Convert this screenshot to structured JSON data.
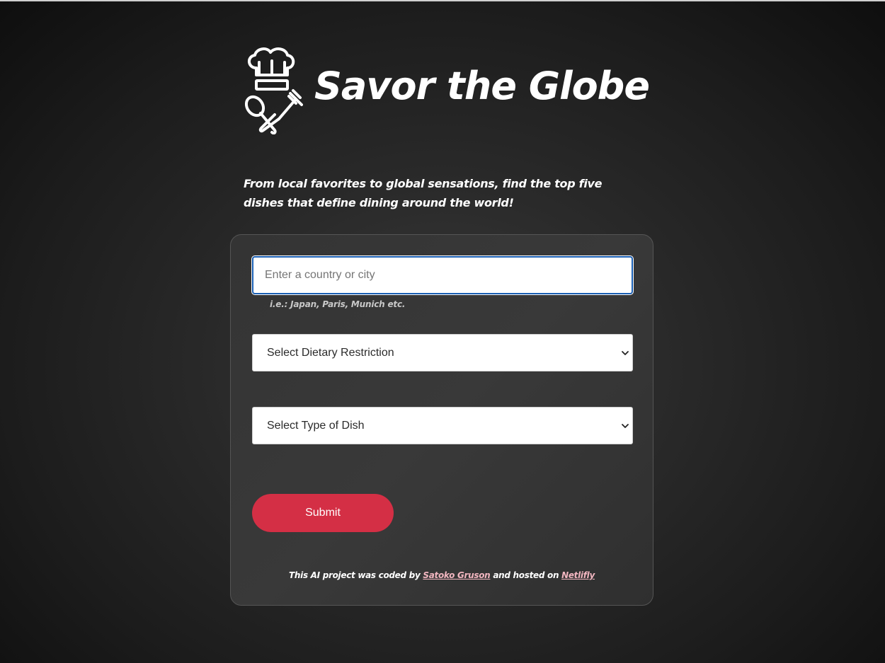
{
  "header": {
    "title": "Savor the Globe",
    "logo_icon": "chef-hat-utensils-icon"
  },
  "tagline": "From local favorites to global sensations, find the top five dishes that define dining around the world!",
  "form": {
    "location_input": {
      "placeholder": "Enter a country or city",
      "value": ""
    },
    "hint": "i.e.: Japan, Paris, Munich etc.",
    "dietary_select": {
      "selected": "Select Dietary Restriction"
    },
    "dish_type_select": {
      "selected": "Select Type of Dish"
    },
    "submit_label": "Submit"
  },
  "footer": {
    "prefix": "This AI project was coded by",
    "author_link": "Satoko Gruson",
    "middle": "and hosted on",
    "host_link": "Netlifly"
  },
  "colors": {
    "accent": "#d42f45",
    "link": "#f2b6c0",
    "focus_border": "#1a5fb4"
  }
}
